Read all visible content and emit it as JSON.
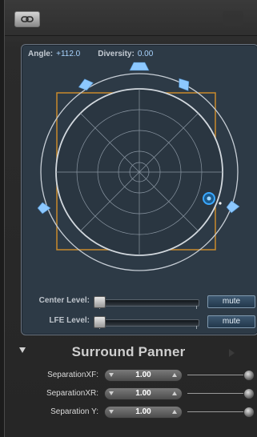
{
  "toolbar": {
    "link_icon": "link-icon"
  },
  "panner": {
    "angle_label": "Angle:",
    "angle_value": "+112.0",
    "diversity_label": "Diversity:",
    "diversity_value": "0.00",
    "speaker_icon": "speaker-icon",
    "colors": {
      "frame": "#c98a2c",
      "grid": "#9aa5b0",
      "ring": "#c7ced6",
      "puck": "#3aa8ff",
      "speaker": "#8cc8ff"
    }
  },
  "levels": {
    "center_label": "Center Level:",
    "lfe_label": "LFE Level:",
    "mute_label": "mute"
  },
  "section": {
    "title": "Surround Panner",
    "collapse_icon": "disclosure-triangle-icon"
  },
  "params": [
    {
      "label": "SeparationXF:",
      "value": "1.00"
    },
    {
      "label": "SeparationXR:",
      "value": "1.00"
    },
    {
      "label": "Separation Y:",
      "value": "1.00"
    }
  ]
}
